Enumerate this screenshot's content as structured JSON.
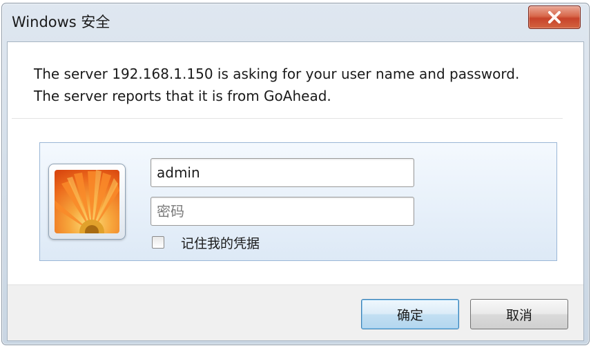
{
  "window": {
    "title": "Windows 安全"
  },
  "message": "The server 192.168.1.150 is asking for your user name and password. The server reports that it is from GoAhead.",
  "credentials": {
    "username_value": "admin",
    "password_placeholder": "密码",
    "remember_label": "记住我的凭据",
    "remember_checked": false
  },
  "buttons": {
    "ok": "确定",
    "cancel": "取消"
  },
  "icons": {
    "close": "close-icon",
    "avatar": "user-avatar-flower"
  },
  "colors": {
    "close_button": "#c7432a",
    "panel": "#dde9f6",
    "ok_border": "#3c7fb1"
  }
}
